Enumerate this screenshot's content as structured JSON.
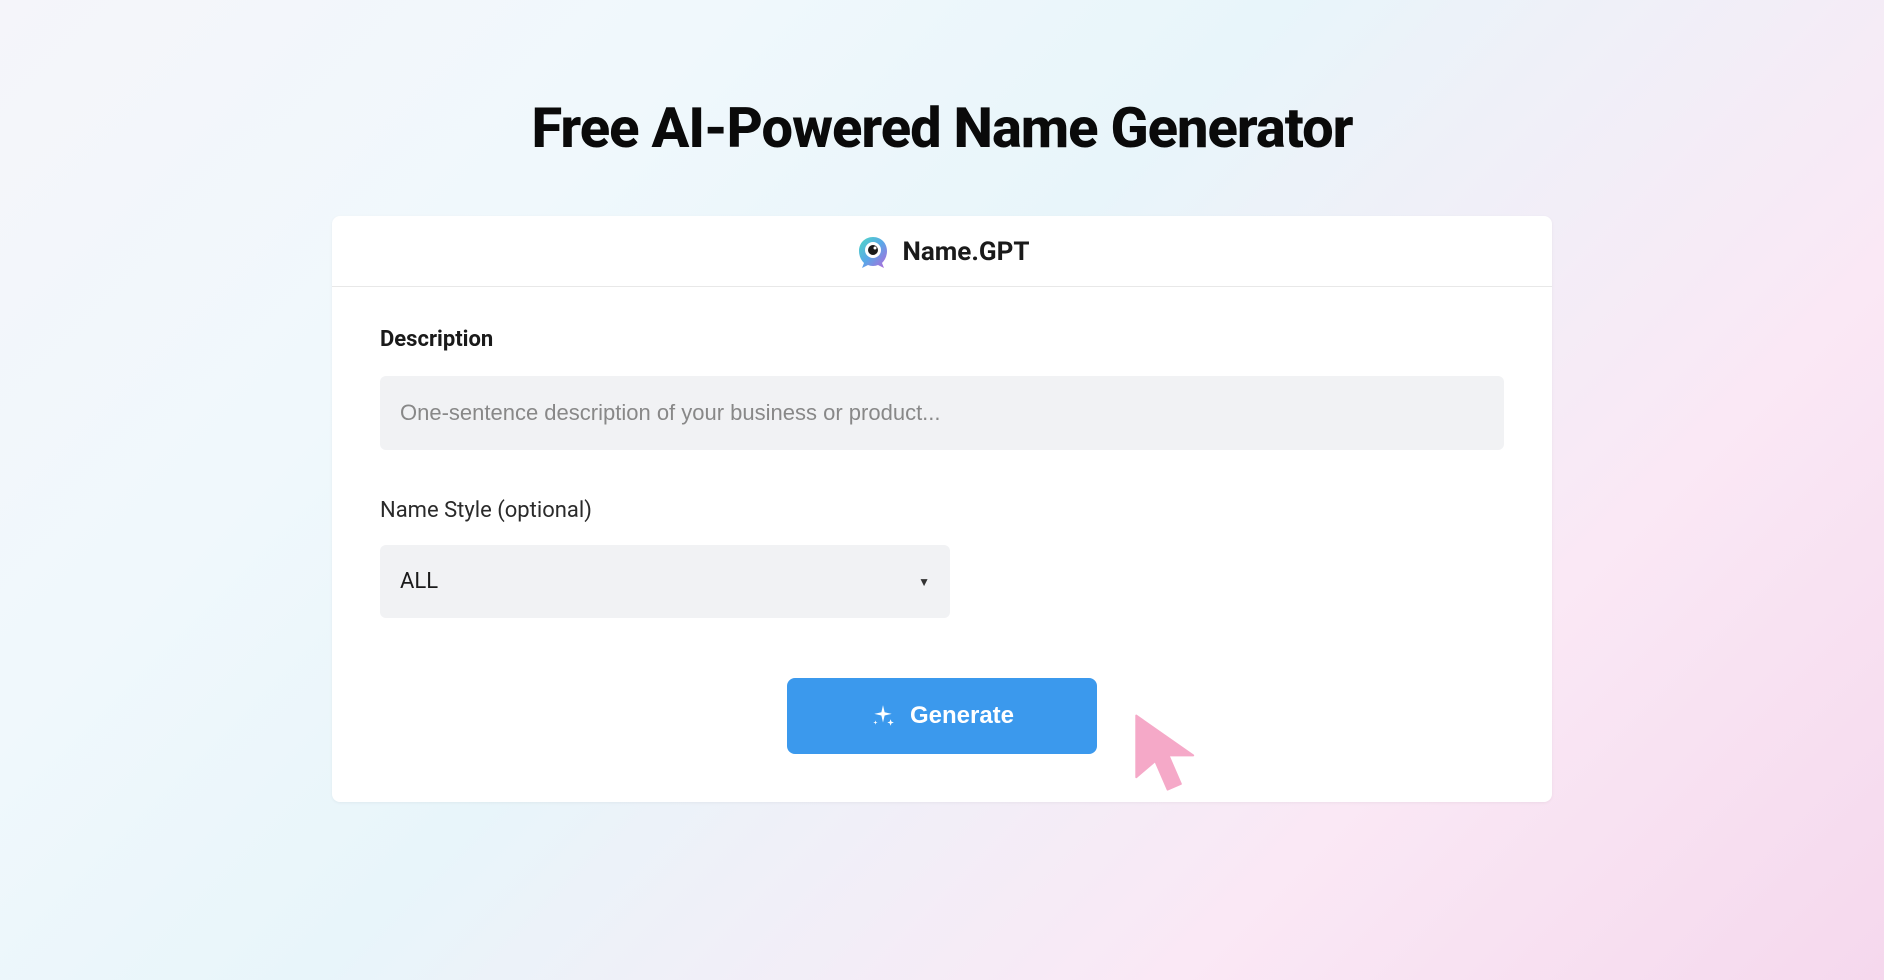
{
  "page": {
    "title": "Free AI-Powered Name Generator"
  },
  "card": {
    "brand": "Name.GPT",
    "description_label": "Description",
    "description_placeholder": "One-sentence description of your business or product...",
    "description_value": "",
    "style_label": "Name Style (optional)",
    "style_selected": "ALL",
    "generate_label": "Generate"
  },
  "colors": {
    "primary": "#3b99ed",
    "cursor": "#f5a9c8"
  }
}
